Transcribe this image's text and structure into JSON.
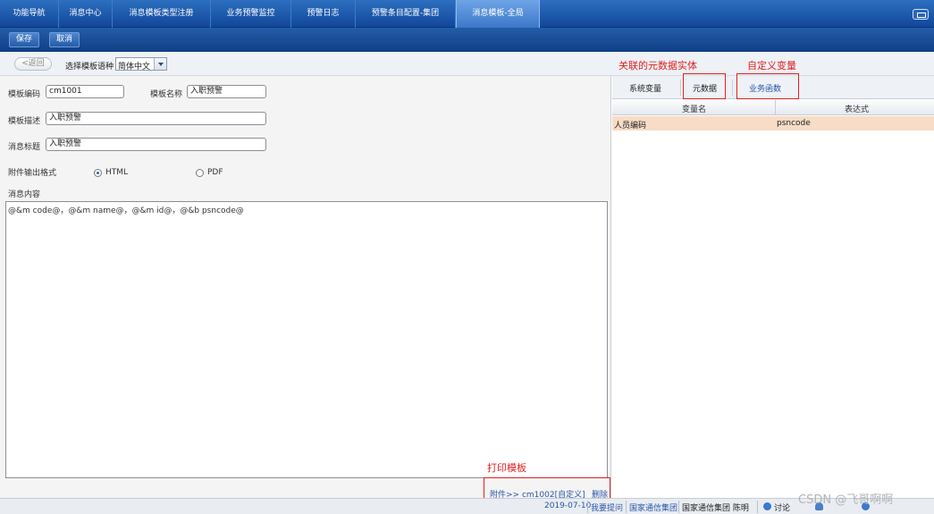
{
  "top_tabs": [
    "功能导航",
    "消息中心",
    "消息模板类型注册",
    "业务预警监控",
    "预警日志",
    "预警条目配置-集团",
    "消息模板-全局"
  ],
  "toolbar": {
    "save_label": "保存",
    "cancel_label": "取消"
  },
  "lang_row": {
    "back_label": "<返回",
    "select_label": "选择模板语种",
    "selected_language": "简体中文"
  },
  "annotations": {
    "metadata_entity": "关联的元数据实体",
    "custom_variable": "自定义变量",
    "print_template": "打印模板"
  },
  "form": {
    "code_label": "模板编码",
    "code_value": "cm1001",
    "name_label": "模板名称",
    "name_value": "入职预警",
    "desc_label": "模板描述",
    "desc_value": "入职预警",
    "subject_label": "消息标题",
    "subject_value": "入职预警",
    "format_label": "附件输出格式",
    "format_options": [
      "HTML",
      "PDF"
    ],
    "format_selected": "HTML",
    "content_label": "消息内容",
    "content_value": "@&m code@，@&m name@，@&m id@，@&b psncode@"
  },
  "attachment": {
    "text": "附件>> cm1002[自定义]",
    "delete_label": "删除"
  },
  "right_panel": {
    "tabs": [
      "系统变量",
      "元数据",
      "业务函数"
    ],
    "active_tab": "业务函数",
    "columns": [
      "变量名",
      "表达式"
    ],
    "rows": [
      {
        "name": "人员编码",
        "expression": "psncode"
      }
    ]
  },
  "status_bar": {
    "date": "2019-07-10",
    "ask": "我要提问",
    "org": "国家通信集团",
    "user": "国家通信集团 陈明",
    "discuss": "讨论"
  },
  "watermark": "CSDN @飞哥啊啊",
  "colors": {
    "accent_blue": "#1d55a4",
    "annotation_red": "#e02020",
    "selected_row": "#f7dcc6"
  }
}
